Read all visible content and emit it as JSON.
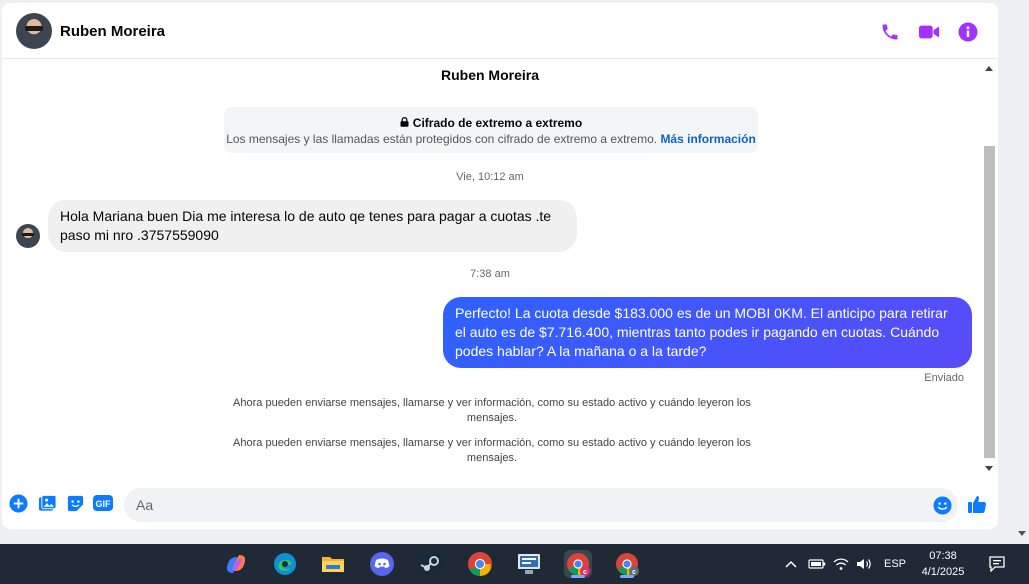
{
  "header": {
    "contact_name": "Ruben Moreira",
    "icons": [
      "phone-icon",
      "video-icon",
      "info-icon"
    ],
    "accent_color": "#a033ff"
  },
  "chat": {
    "title": "Ruben Moreira",
    "encryption": {
      "title": "Cifrado de extremo a extremo",
      "text": "Los mensajes y las llamadas están protegidos con cifrado de extremo a extremo.",
      "link": "Más información"
    },
    "messages": [
      {
        "timestamp": "Vie, 10:12 am",
        "direction": "incoming",
        "text": "Hola Mariana buen Dia me interesa lo de auto qe tenes para pagar a cuotas .te paso mi nro .3757559090"
      },
      {
        "timestamp": "7:38 am",
        "direction": "outgoing",
        "text": "Perfecto! La cuota desde $183.000 es de un MOBI 0KM. El anticipo para retirar el auto es de $7.716.400, mientras tanto podes ir pagando en cuotas. Cuándo podes hablar? A la mañana o a la tarde?"
      }
    ],
    "sent_status": "Enviado",
    "notices": [
      "Ahora pueden enviarse mensajes, llamarse y ver información, como su estado activo y cuándo leyeron los mensajes.",
      "Ahora pueden enviarse mensajes, llamarse y ver información, como su estado activo y cuándo leyeron los mensajes."
    ],
    "outgoing_color": "#3a5bff"
  },
  "composer": {
    "placeholder": "Aa",
    "icons": [
      "plus-icon",
      "image-icon",
      "sticker-icon",
      "gif-icon",
      "emoji-icon",
      "like-icon"
    ],
    "gif_label": "GIF"
  },
  "taskbar": {
    "apps": [
      "copilot-icon",
      "edge-icon",
      "file-explorer-icon",
      "discord-icon",
      "steam-icon",
      "chrome-icon",
      "app-icon",
      "chrome-profile-icon",
      "chrome-profile-icon"
    ],
    "language": "ESP",
    "time": "07:38",
    "date": "4/1/2025"
  }
}
